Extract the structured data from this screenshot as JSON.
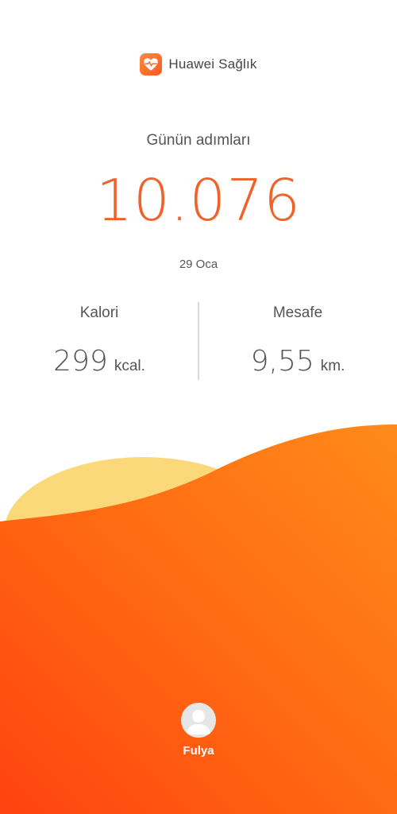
{
  "header": {
    "app_title": "Huawei Sağlık",
    "icon": "heart-pulse-icon"
  },
  "steps": {
    "label": "Günün adımları",
    "value": "10.076"
  },
  "date": "29 Oca",
  "stats": {
    "calories": {
      "label": "Kalori",
      "value": "299",
      "unit": "kcal."
    },
    "distance": {
      "label": "Mesafe",
      "value": "9,55",
      "unit": "km."
    }
  },
  "profile": {
    "name": "Fulya",
    "icon": "user-avatar-icon"
  },
  "colors": {
    "accent": "#f0622a",
    "wave_orange": "#ff7a14",
    "wave_red": "#ff4a12",
    "sun": "#fbd97a"
  }
}
